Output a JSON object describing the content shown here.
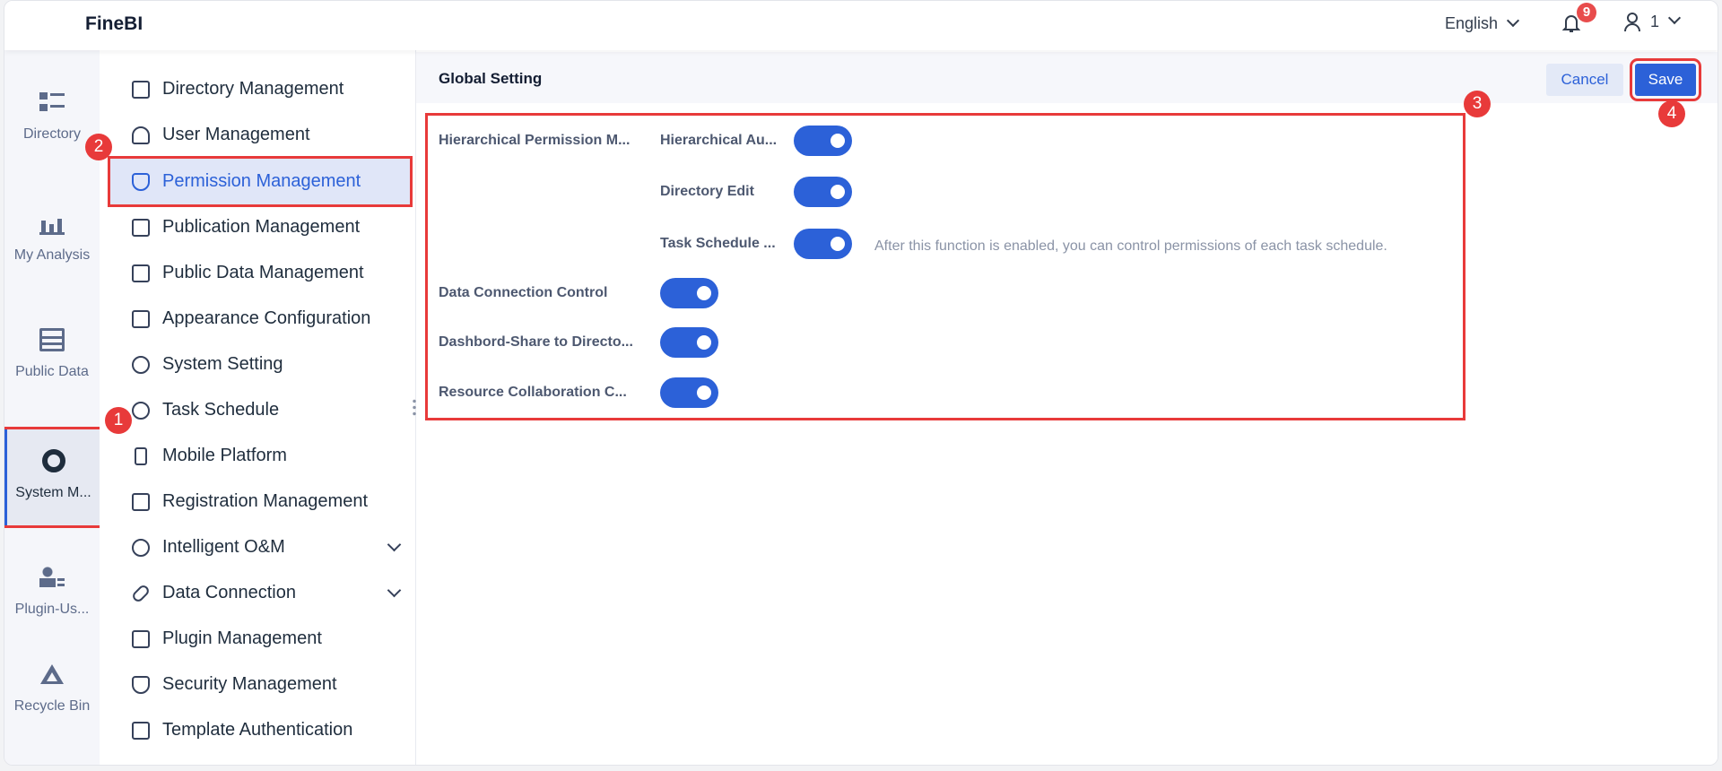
{
  "header": {
    "logo": "FineBI",
    "language": "English",
    "notifications": "9",
    "user": "1"
  },
  "rail": [
    {
      "label": "Directory"
    },
    {
      "label": "My Analysis"
    },
    {
      "label": "Public Data"
    },
    {
      "label": "System M..."
    },
    {
      "label": "Plugin-Us..."
    },
    {
      "label": "Recycle Bin"
    }
  ],
  "menu": [
    {
      "label": "Directory Management"
    },
    {
      "label": "User Management"
    },
    {
      "label": "Permission Management"
    },
    {
      "label": "Publication Management"
    },
    {
      "label": "Public Data Management"
    },
    {
      "label": "Appearance Configuration"
    },
    {
      "label": "System Setting"
    },
    {
      "label": "Task Schedule"
    },
    {
      "label": "Mobile Platform"
    },
    {
      "label": "Registration Management"
    },
    {
      "label": "Intelligent O&M"
    },
    {
      "label": "Data Connection"
    },
    {
      "label": "Plugin Management"
    },
    {
      "label": "Security Management"
    },
    {
      "label": "Template Authentication"
    }
  ],
  "content": {
    "title": "Global Setting",
    "cancel": "Cancel",
    "save": "Save",
    "group_label": "Hierarchical Permission M...",
    "sub_settings": [
      {
        "label": "Hierarchical Au...",
        "enabled": true
      },
      {
        "label": "Directory Edit",
        "enabled": true
      },
      {
        "label": "Task Schedule ...",
        "enabled": true
      }
    ],
    "hint": "After this function is enabled, you can control permissions of each task schedule.",
    "settings": [
      {
        "label": "Data Connection Control",
        "enabled": true
      },
      {
        "label": "Dashbord-Share to Directo...",
        "enabled": true
      },
      {
        "label": "Resource Collaboration C...",
        "enabled": true
      }
    ]
  },
  "annotations": [
    "1",
    "2",
    "3",
    "4"
  ],
  "colors": {
    "accent": "#2c61d8",
    "annotation": "#e83a3a"
  }
}
